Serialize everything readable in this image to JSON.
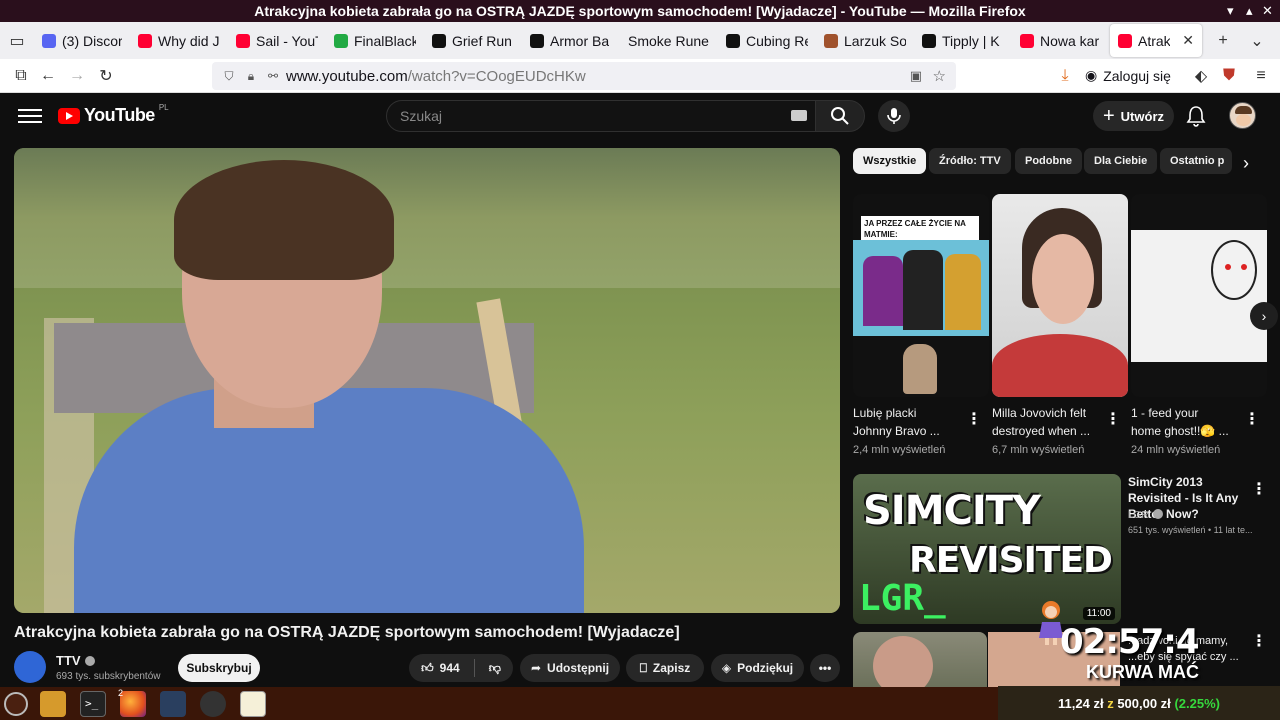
{
  "window": {
    "title": "Atrakcyjna kobieta zabrała go na OSTRĄ JAZDĘ sportowym samochodem! [Wyjadacze] - YouTube — Mozilla Firefox"
  },
  "tabs": [
    {
      "label": "(3) Discor",
      "color": "#5865f2"
    },
    {
      "label": "Why did J",
      "color": "#ff0033"
    },
    {
      "label": "Sail - YouT",
      "color": "#ff0033"
    },
    {
      "label": "FinalBlack",
      "color": "#22aa44"
    },
    {
      "label": "Grief Run",
      "color": "#111111"
    },
    {
      "label": "Armor Ba",
      "color": "#111111"
    },
    {
      "label": "Smoke Rune",
      "color": ""
    },
    {
      "label": "Cubing Re",
      "color": "#111111"
    },
    {
      "label": "Larzuk So",
      "color": "#a0522d"
    },
    {
      "label": "Tipply | K",
      "color": "#111111"
    },
    {
      "label": "Nowa kar",
      "color": "#ff0033"
    },
    {
      "label": "Atrakcyj",
      "color": "#ff0033"
    }
  ],
  "navbar": {
    "url_host": "www.youtube.com",
    "url_path": "/watch?v=COogEUDcHKw",
    "login_label": "Zaloguj się"
  },
  "youtube": {
    "logo_text": "YouTube",
    "region": "PL",
    "search_placeholder": "Szukaj",
    "create_label": "Utwórz"
  },
  "video": {
    "title": "Atrakcyjna kobieta zabrała go na OSTRĄ JAZDĘ sportowym samochodem! [Wyjadacze]",
    "channel": "TTV",
    "subscribers": "693 tys. subskrybentów",
    "subscribe_label": "Subskrybuj",
    "likes": "944",
    "share_label": "Udostępnij",
    "save_label": "Zapisz",
    "thanks_label": "Podziękuj"
  },
  "chips": [
    "Wszystkie",
    "Źródło: TTV",
    "Podobne",
    "Dla Ciebie",
    "Ostatnio p"
  ],
  "shorts": [
    {
      "title_line1": "Lubię placki",
      "title_line2": "Johnny Bravo ...",
      "views": "2,4 mln wyświetleń",
      "caption": "JA PRZEZ CAŁE ŻYCIE NA MATMIE:"
    },
    {
      "title_line1": "Milla Jovovich felt",
      "title_line2": "destroyed when ...",
      "views": "6,7 mln wyświetleń"
    },
    {
      "title_line1": "1 - feed your",
      "title_line2": "home ghost!!🫣 ...",
      "views": "24 mln wyświetleń"
    }
  ],
  "recommended": [
    {
      "title": "SimCity 2013 Revisited - Is It Any Better Now?",
      "channel": "LGR",
      "meta": "651 tys. wyświetleń • 11 lat te...",
      "duration": "11:00",
      "thumb_line1": "SIMCITY",
      "thumb_line2": "REVISITED",
      "thumb_line3": "LGR_"
    },
    {
      "title_fragment": "...adzwoni do mamy, ...eby się spytać czy ..."
    }
  ],
  "overlay": {
    "timer": "02:57:4",
    "subtitle": "KURWA MAĆ"
  },
  "taskbar": {
    "money_amount": "11,24 zł",
    "money_sep": "z",
    "money_goal": "500,00 zł",
    "money_pct": "(2.25%)",
    "badge": "2"
  }
}
